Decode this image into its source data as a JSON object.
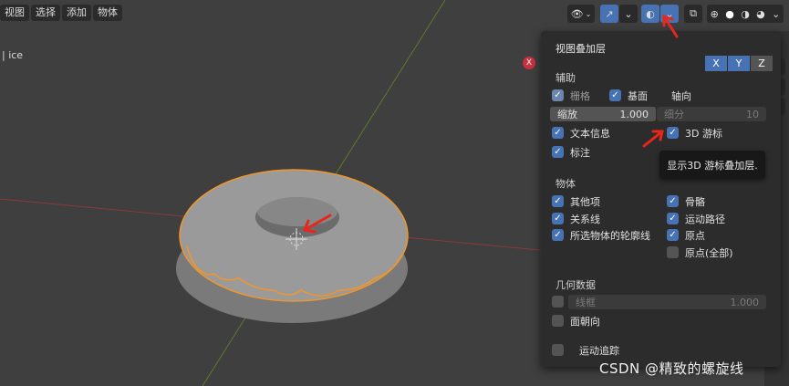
{
  "menu": {
    "items": [
      "视图",
      "选择",
      "添加",
      "物体"
    ]
  },
  "viewport": {
    "object_label": "| ice",
    "axis_marker": "X"
  },
  "header_buttons": [
    "visibility-icon",
    "gizmo-icon",
    "overlay-icon",
    "xray-icon",
    "shading-wireframe-icon",
    "shading-solid-icon",
    "shading-material-icon",
    "shading-rendered-icon"
  ],
  "overlay_panel": {
    "title": "视图叠加层",
    "guides": {
      "heading": "辅助",
      "grid": "栅格",
      "floor": "基面",
      "axes_label": "轴向",
      "axes": [
        "X",
        "Y",
        "Z"
      ],
      "scale_label": "缩放",
      "scale_value": "1.000",
      "subdiv_label": "细分",
      "subdiv_value": "10",
      "text_info": "文本信息",
      "cursor_3d": "3D 游标",
      "annotations": "标注"
    },
    "objects": {
      "heading": "物体",
      "extras": "其他项",
      "bones": "骨骼",
      "relationship_lines": "关系线",
      "motion_paths": "运动路径",
      "outline_selected": "所选物体的轮廓线",
      "origins": "原点",
      "origins_all": "原点(全部)"
    },
    "geometry": {
      "heading": "几何数据",
      "wireframe": "线框",
      "wireframe_value": "1.000",
      "face_orientation": "面朝向"
    },
    "motion_tracking": {
      "label": "运动追踪"
    }
  },
  "tooltip": {
    "text": "显示3D 游标叠加层."
  },
  "watermark": "CSDN @精致的螺旋线",
  "colors": {
    "accent": "#4772b3",
    "outline": "#f0962a",
    "annotation_arrow": "#e8261c"
  }
}
